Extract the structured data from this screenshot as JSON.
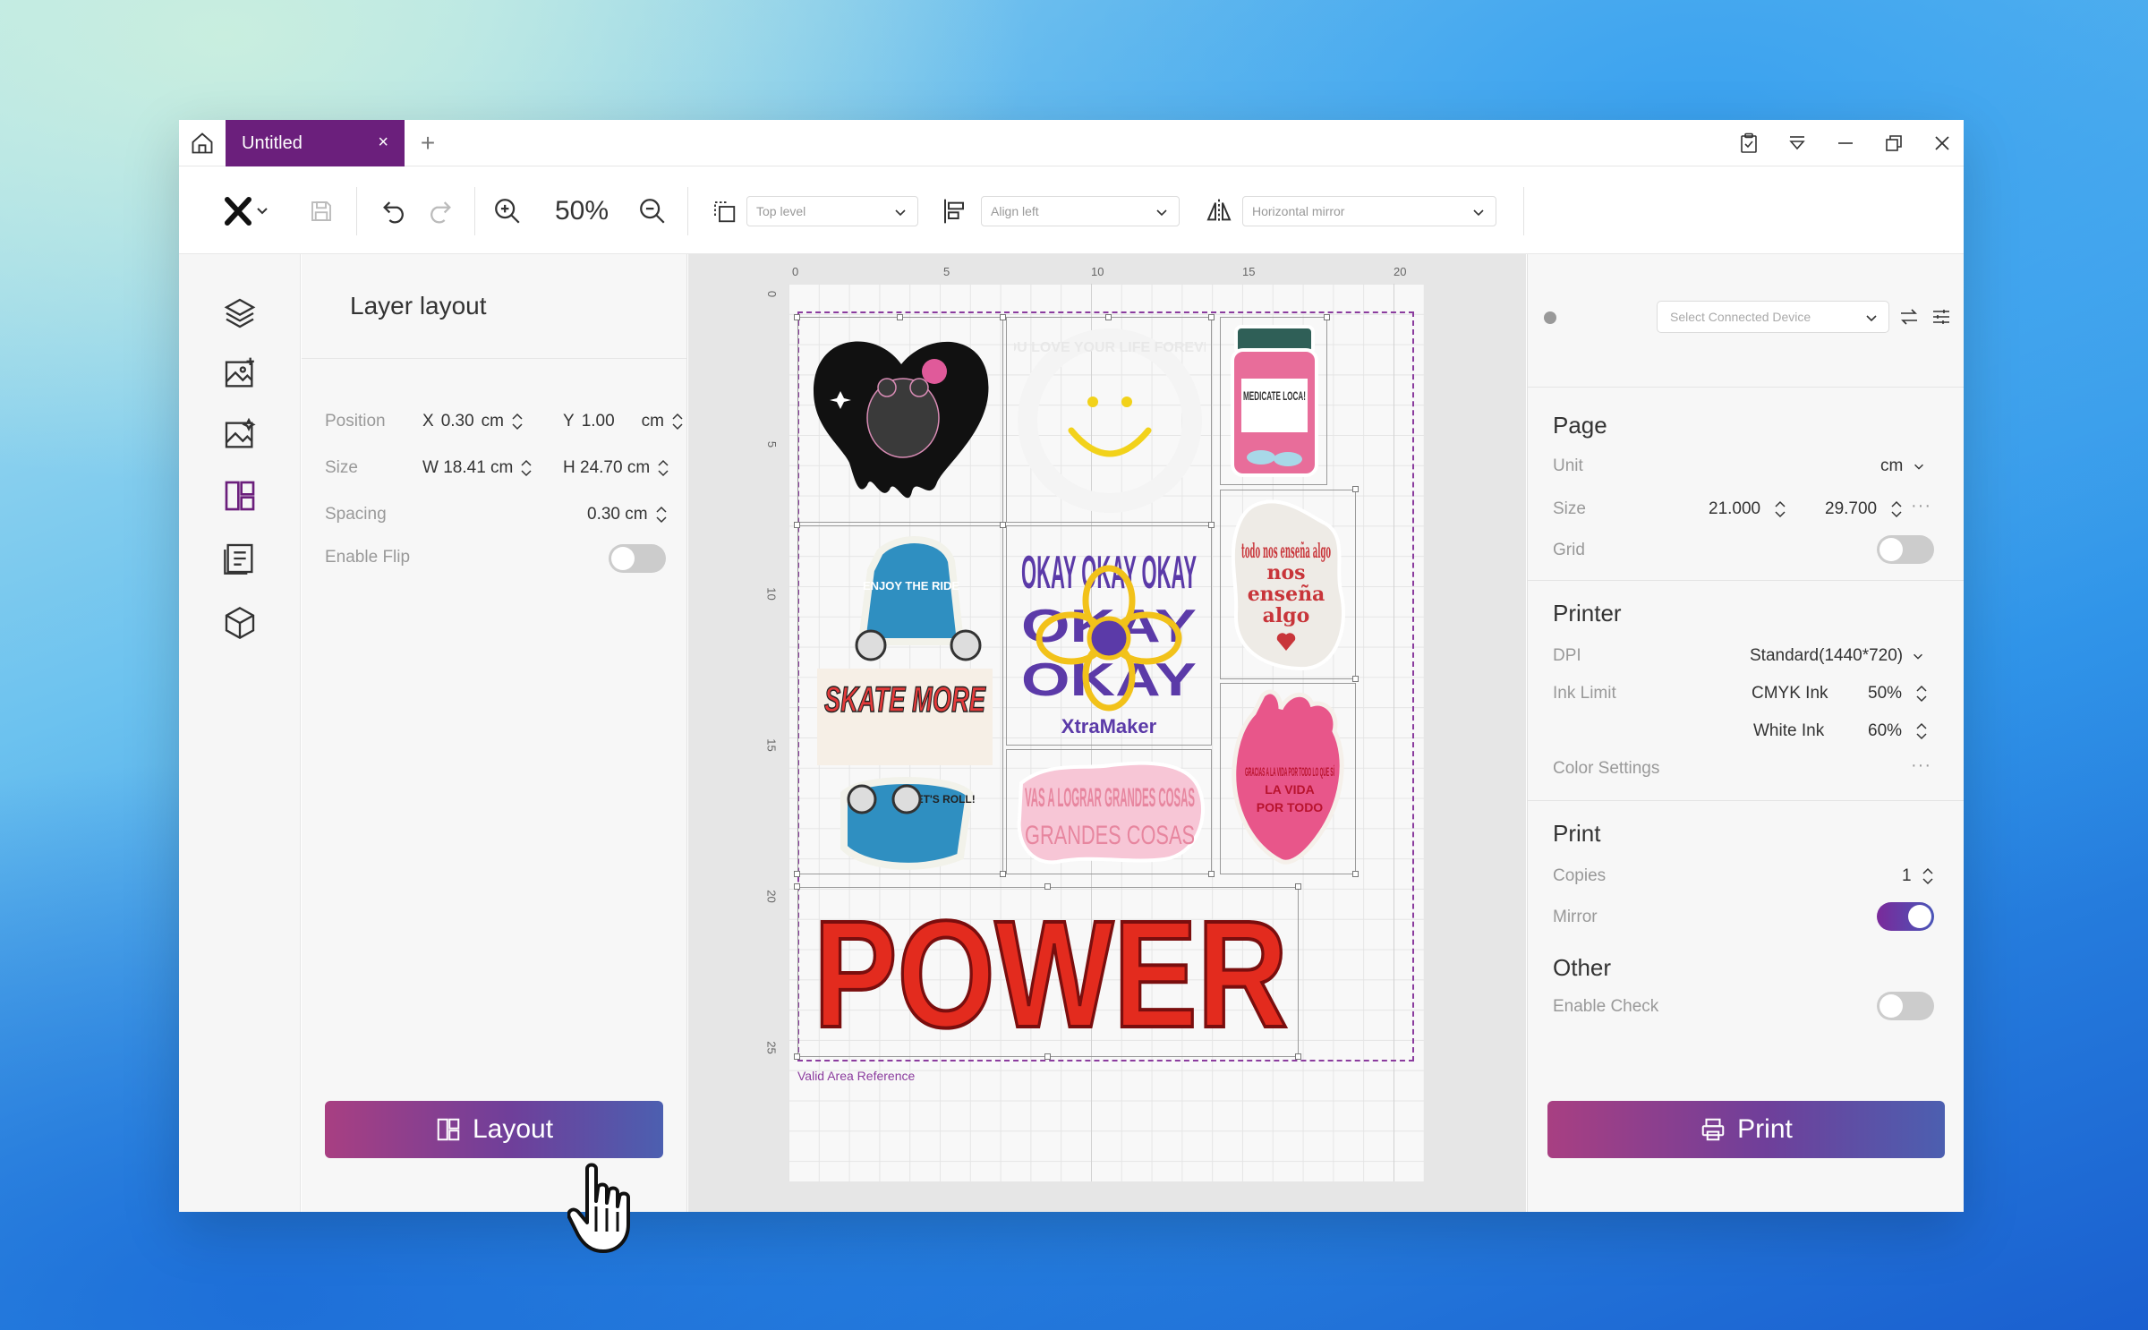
{
  "titlebar": {
    "tab_title": "Untitled",
    "tab_close": "×",
    "tab_add": "+"
  },
  "toolbar": {
    "zoom": "50%",
    "arrange_placeholder": "Top level",
    "align_placeholder": "Align left",
    "mirror_placeholder": "Horizontal mirror"
  },
  "left_panel": {
    "title": "Layer layout",
    "position_label": "Position",
    "pos_x_prefix": "X",
    "pos_x": "0.30",
    "pos_x_unit": "cm",
    "pos_y_prefix": "Y",
    "pos_y": "1.00",
    "pos_y_unit": "cm",
    "size_label": "Size",
    "size_w": "W 18.41 cm",
    "size_h": "H 24.70 cm",
    "spacing_label": "Spacing",
    "spacing_value": "0.30 cm",
    "flip_label": "Enable Flip",
    "flip_on": false,
    "layout_button": "Layout"
  },
  "canvas": {
    "ruler_x": [
      "0",
      "5",
      "10",
      "15",
      "20"
    ],
    "ruler_y": [
      "0",
      "5",
      "10",
      "15",
      "20",
      "25"
    ],
    "valid_area_label": "Valid Area Reference",
    "stickers": {
      "ride_ring": "YOU LOVE YOUR LIFE FOREVER",
      "pill_text": "MEDICATE LOCA!",
      "todo_text": "todo nos enseña algo",
      "skate_ride": "ENJOY THE RIDE",
      "skate_more": "SKATE MORE",
      "skate_roll": "LET'S ROLL!",
      "okay_text": "OKAY OKAY OKAY",
      "brand": "XtraMaker",
      "vas_text": "VAS A LOGRAR GRANDES COSAS",
      "heart_text": "GRACIAS A LA VIDA POR TODO LO QUE SÍ",
      "power_text": "POWER"
    }
  },
  "right_panel": {
    "device_placeholder": "Select Connected Device",
    "page_title": "Page",
    "unit_label": "Unit",
    "unit_value": "cm",
    "size_label": "Size",
    "size_w": "21.000",
    "size_h": "29.700",
    "grid_label": "Grid",
    "grid_on": false,
    "printer_title": "Printer",
    "dpi_label": "DPI",
    "dpi_value": "Standard(1440*720)",
    "ink_limit_label": "Ink Limit",
    "cmyk_label": "CMYK Ink",
    "cmyk_value": "50%",
    "white_label": "White Ink",
    "white_value": "60%",
    "color_settings_label": "Color Settings",
    "more_dots": "···",
    "print_title": "Print",
    "copies_label": "Copies",
    "copies_value": "1",
    "mirror_label": "Mirror",
    "mirror_on": true,
    "other_title": "Other",
    "check_label": "Enable Check",
    "check_on": false,
    "print_button": "Print"
  },
  "colors": {
    "accent": "#6b1f7c",
    "button_start": "#a83f82",
    "button_end": "#4c5fb0",
    "valid_area": "#8b3c9e"
  }
}
